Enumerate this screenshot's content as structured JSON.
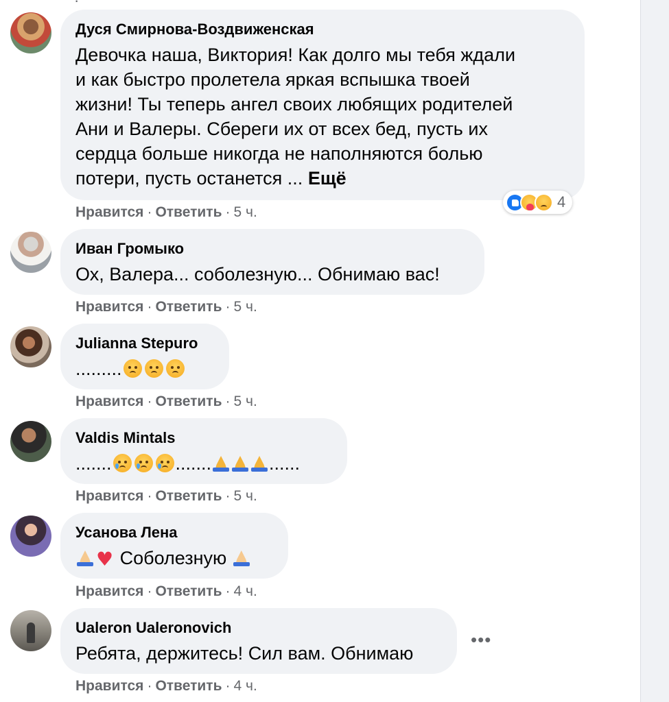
{
  "comments": [
    {
      "author": "Дуся Смирнова-Воздвиженская",
      "lines": [
        "Девочка наша, Виктория! Как долго мы тебя ждали",
        "и как быстро пролетела яркая вспышка твоей",
        "жизни! Ты теперь ангел своих любящих родителей",
        "Ани и Валеры. Сбереги их от всех бед, пусть их",
        "сердца больше никогда не наполняются болью",
        "потери, пусть останется ..."
      ],
      "more_label": "Ещё",
      "like_label": "Нравится",
      "reply_label": "Ответить",
      "time": "5 ч.",
      "reaction_icons": [
        "like-icon",
        "care-icon",
        "sad-icon"
      ],
      "reaction_count": "4"
    },
    {
      "author": "Иван Громыко",
      "text": "Ох, Валера... соболезную... Обнимаю вас!",
      "like_label": "Нравится",
      "reply_label": "Ответить",
      "time": "5 ч."
    },
    {
      "author": "Julianna Stepuro",
      "text_prefix": ".........",
      "emojis": [
        "sad-face-icon",
        "sad-face-icon",
        "sad-face-icon"
      ],
      "like_label": "Нравится",
      "reply_label": "Ответить",
      "time": "5 ч."
    },
    {
      "author": "Valdis Mintals",
      "text_prefix": ".......",
      "text_middle": ".......",
      "text_suffix": "......",
      "emojis_1": [
        "crying-face-icon",
        "crying-face-icon",
        "crying-face-icon"
      ],
      "emojis_2": [
        "folded-hands-icon",
        "folded-hands-icon",
        "folded-hands-icon"
      ],
      "like_label": "Нравится",
      "reply_label": "Ответить",
      "time": "5 ч."
    },
    {
      "author": "Усанова Лена",
      "text": "Соболезную",
      "emojis_before": [
        "folded-hands-icon",
        "heart-icon"
      ],
      "emojis_after": [
        "folded-hands-icon"
      ],
      "like_label": "Нравится",
      "reply_label": "Ответить",
      "time": "4 ч."
    },
    {
      "author": "Ualeron Ualeronovich",
      "text": "Ребята, держитесь! Сил вам. Обнимаю",
      "like_label": "Нравится",
      "reply_label": "Ответить",
      "time": "4 ч.",
      "more_options": "•••"
    }
  ],
  "separator": "·",
  "colors": {
    "bubble": "#f0f2f5",
    "secondary_text": "#65676b",
    "like_blue": "#1877f2"
  }
}
